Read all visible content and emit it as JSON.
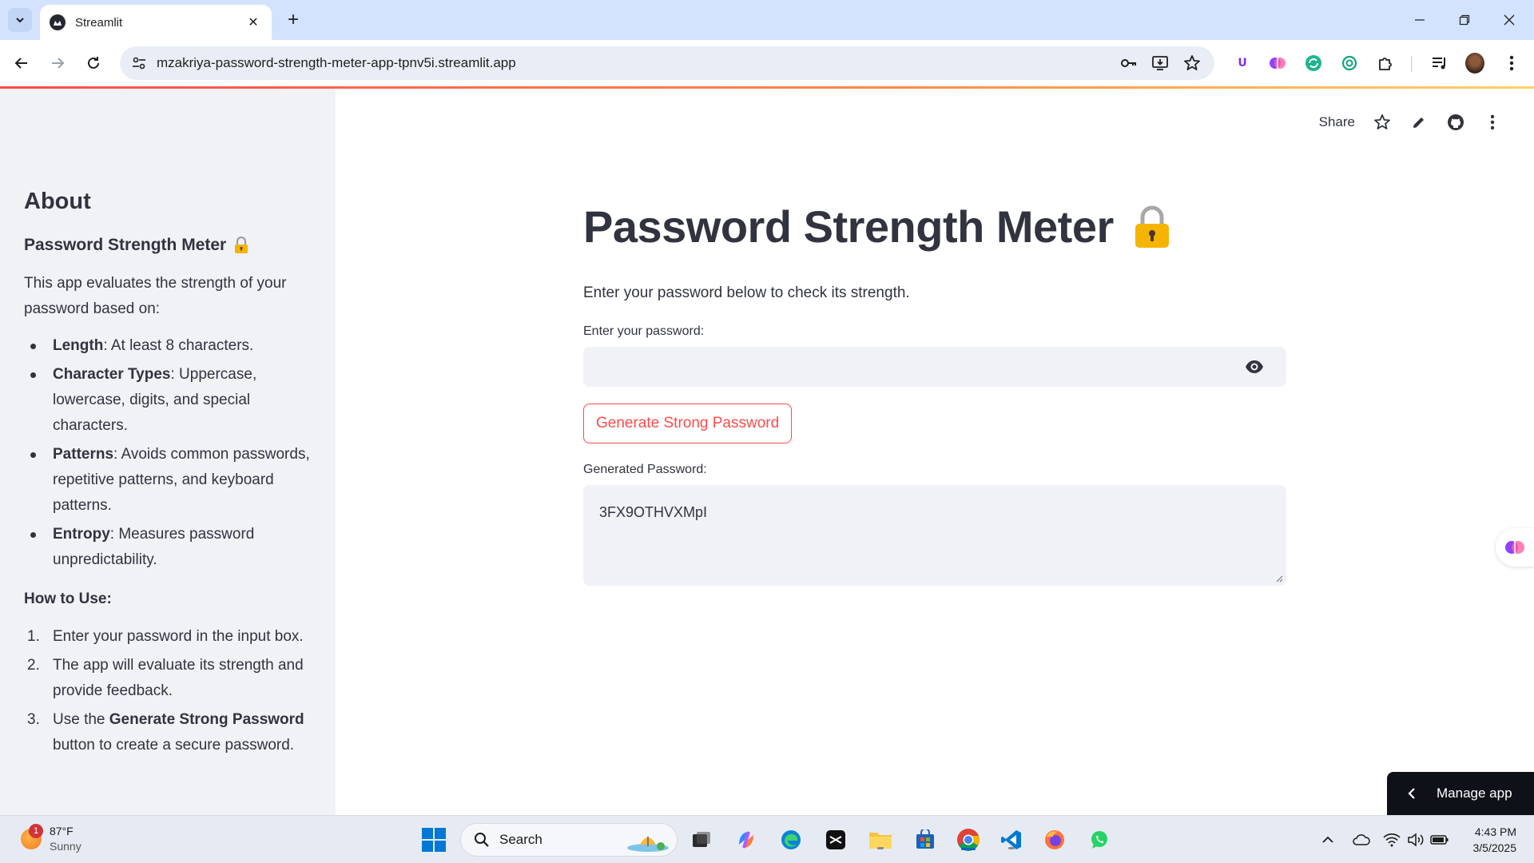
{
  "browser": {
    "tab_title": "Streamlit",
    "url": "mzakriya-password-strength-meter-app-tpnv5i.streamlit.app"
  },
  "sidebar": {
    "about": "About",
    "app_title": "Password Strength Meter",
    "intro": "This app evaluates the strength of your password based on:",
    "criteria": [
      {
        "term": "Length",
        "desc": ": At least 8 characters."
      },
      {
        "term": "Character Types",
        "desc": ": Uppercase, lowercase, digits, and special characters."
      },
      {
        "term": "Patterns",
        "desc": ": Avoids common passwords, repetitive patterns, and keyboard patterns."
      },
      {
        "term": "Entropy",
        "desc": ": Measures password unpredictability."
      }
    ],
    "how_to_use": "How to Use:",
    "steps": [
      {
        "num": "1.",
        "pre": "Enter your password in the input box.",
        "bold": "",
        "post": ""
      },
      {
        "num": "2.",
        "pre": "The app will evaluate its strength and provide feedback.",
        "bold": "",
        "post": ""
      },
      {
        "num": "3.",
        "pre": "Use the ",
        "bold": "Generate Strong Password",
        "post": " button to create a secure password."
      }
    ]
  },
  "header": {
    "share": "Share"
  },
  "main": {
    "title": "Password Strength Meter",
    "subtitle": "Enter your password below to check its strength.",
    "password_label": "Enter your password:",
    "password_value": "",
    "generate_button": "Generate Strong Password",
    "generated_label": "Generated Password:",
    "generated_value": "3FX9OTHVXMpI"
  },
  "manage_app": "Manage app",
  "taskbar": {
    "weather_temp": "87°F",
    "weather_cond": "Sunny",
    "weather_badge": "1",
    "search": "Search",
    "time": "4:43 PM",
    "date": "3/5/2025"
  },
  "colors": {
    "accent": "#ff4b4b",
    "sidebar_bg": "#f0f2f6",
    "text": "#31333f"
  }
}
